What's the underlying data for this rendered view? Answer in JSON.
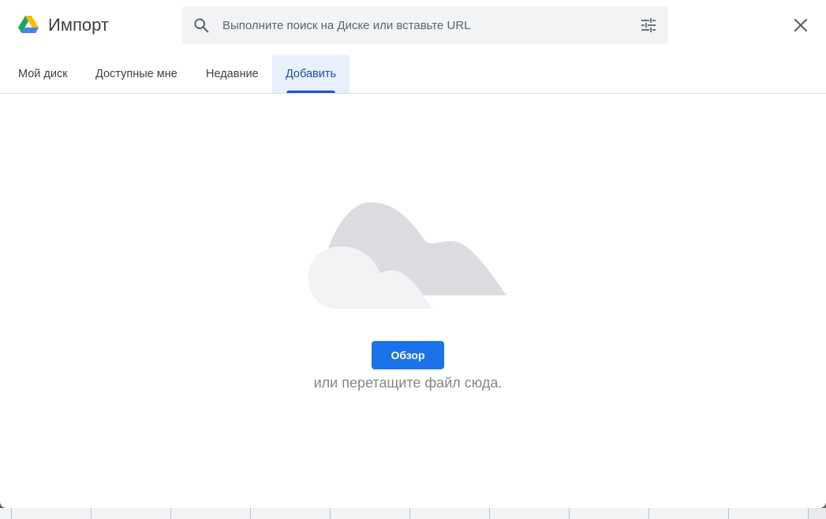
{
  "header": {
    "title": "Импорт",
    "logo_icon": "google-drive-logo-icon",
    "close_icon": "close-icon"
  },
  "search": {
    "placeholder": "Выполните поиск на Диске или вставьте URL",
    "value": "",
    "search_icon": "search-icon",
    "options_icon": "tune-icon"
  },
  "tabs": [
    {
      "label": "Мой диск",
      "active": false
    },
    {
      "label": "Доступные мне",
      "active": false
    },
    {
      "label": "Недавние",
      "active": false
    },
    {
      "label": "Добавить",
      "active": true
    }
  ],
  "upload": {
    "illustration": "cloud-icon",
    "browse_label": "Обзор",
    "drag_text": "или перетащите файл сюда."
  },
  "colors": {
    "accent": "#1a73e8",
    "active_tab_bg": "#e8f0fe",
    "active_tab_text": "#1a4fa0",
    "text_secondary": "#80868b"
  }
}
